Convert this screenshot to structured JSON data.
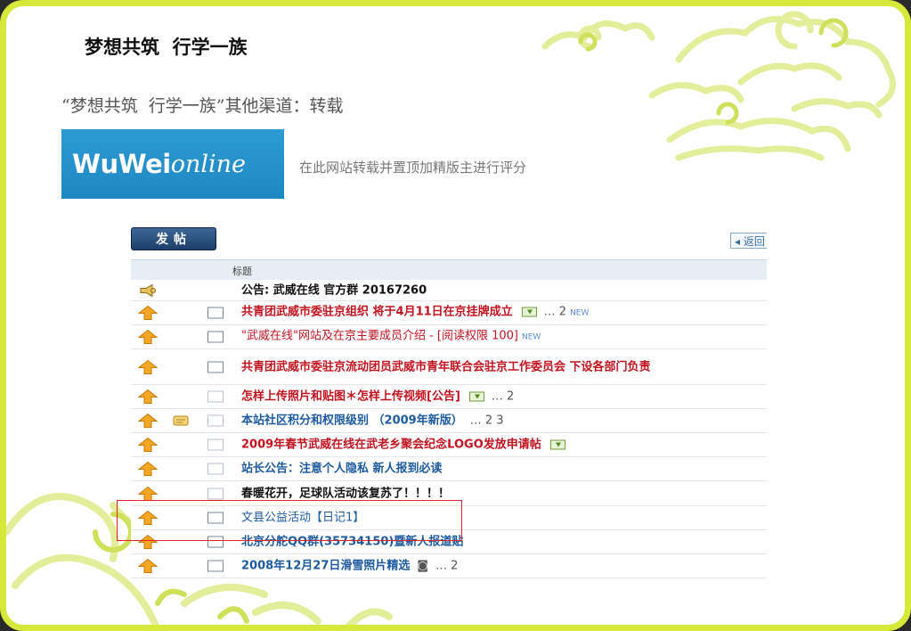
{
  "slide": {
    "title": "梦想共筑  行学一族",
    "subtitle": "“梦想共筑  行学一族”其他渠道：转载",
    "logo": {
      "part1": "WuWei",
      "part2": "online"
    },
    "logo_caption": "在此网站转载并置顶加精版主进行评分"
  },
  "forum": {
    "post_button": "发帖",
    "back_button": "◂ 返回",
    "header_title": "标题",
    "rows": [
      {
        "icon": "announcement-icon",
        "text": "公告: 武威在线 官方群 20167260",
        "color": "black"
      },
      {
        "icon": "pinned-arrow-icon",
        "text": "共青团武威市委驻京组织 将于4月11日在京挂牌成立",
        "attach": true,
        "extra": "… 2",
        "new": "NEW",
        "color": "red"
      },
      {
        "icon": "pinned-arrow-icon",
        "text": "\"武威在线\"网站及在京主要成员介绍 - [阅读权限 100]",
        "new": "NEW",
        "color": "red",
        "normal": true
      },
      {
        "icon": "pinned-arrow-icon",
        "text": "共青团武威市委驻京流动团员武威市青年联合会驻京工作委员会 下设各部门负责",
        "color": "red"
      },
      {
        "icon": "pinned-arrow-icon",
        "text": "怎样上传照片和贴图＊怎样上传视频[公告]",
        "attach": true,
        "extra": "… 2",
        "color": "red"
      },
      {
        "icon": "pinned-arrow-icon",
        "text": "本站社区积分和权限级别 （2009年新版）",
        "extra": "… 2 3",
        "color": "blue",
        "hot": true
      },
      {
        "icon": "pinned-arrow-icon",
        "text": "2009年春节武威在线在武老乡聚会纪念LOGO发放申请帖",
        "attach": true,
        "color": "red"
      },
      {
        "icon": "pinned-arrow-icon",
        "text": "站长公告：注意个人隐私 新人报到必读",
        "color": "blue"
      },
      {
        "icon": "pinned-arrow-icon",
        "text": "春暖花开，足球队活动该复苏了！！！！",
        "color": "black"
      },
      {
        "icon": "pinned-arrow-icon",
        "text": "文县公益活动【日记1】",
        "color": "blue",
        "normal": true
      },
      {
        "icon": "pinned-arrow-icon",
        "text": "北京分舵QQ群(35734150)暨新人报道贴",
        "color": "blue"
      },
      {
        "icon": "pinned-arrow-icon",
        "text": "2008年12月27日滑雪照片精选",
        "extra": "… 2",
        "color": "blue",
        "image": true
      }
    ]
  },
  "colors": {
    "border": "#d6e83a",
    "accent_red": "#c0131f",
    "accent_blue": "#1d5a9e",
    "logo_bg": "#1f87c2",
    "highlight": "#e0202a"
  }
}
